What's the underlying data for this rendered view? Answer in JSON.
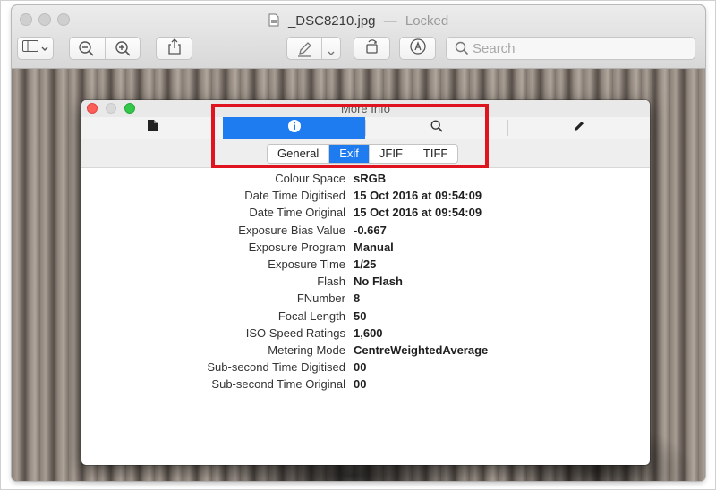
{
  "window": {
    "title": "_DSC8210.jpg",
    "separator": "—",
    "state": "Locked"
  },
  "toolbar": {
    "icons": [
      "sidebar-icon",
      "chevron-down-icon",
      "zoom-out-icon",
      "zoom-in-icon",
      "share-icon",
      "markup-pen-icon",
      "chevron-down-icon",
      "rotate-icon",
      "annotate-icon",
      "search-icon"
    ]
  },
  "search": {
    "placeholder": "Search",
    "value": ""
  },
  "info_panel": {
    "title": "More Info",
    "tabs": [
      {
        "icon": "document-icon",
        "active": false
      },
      {
        "icon": "info-icon",
        "active": true
      },
      {
        "icon": "magnifier-icon",
        "active": false
      },
      {
        "icon": "pencil-icon",
        "active": false
      }
    ],
    "sub_tabs": [
      {
        "label": "General",
        "active": false
      },
      {
        "label": "Exif",
        "active": true
      },
      {
        "label": "JFIF",
        "active": false
      },
      {
        "label": "TIFF",
        "active": false
      }
    ],
    "exif": [
      {
        "key": "Colour Space",
        "value": "sRGB"
      },
      {
        "key": "Date Time Digitised",
        "value": "15 Oct 2016 at 09:54:09"
      },
      {
        "key": "Date Time Original",
        "value": "15 Oct 2016 at 09:54:09"
      },
      {
        "key": "Exposure Bias Value",
        "value": "-0.667"
      },
      {
        "key": "Exposure Program",
        "value": "Manual"
      },
      {
        "key": "Exposure Time",
        "value": "1/25"
      },
      {
        "key": "Flash",
        "value": "No Flash"
      },
      {
        "key": "FNumber",
        "value": "8"
      },
      {
        "key": "Focal Length",
        "value": "50"
      },
      {
        "key": "ISO Speed Ratings",
        "value": "1,600"
      },
      {
        "key": "Metering Mode",
        "value": "CentreWeightedAverage"
      },
      {
        "key": "Sub-second Time Digitised",
        "value": "00"
      },
      {
        "key": "Sub-second Time Original",
        "value": "00"
      }
    ]
  },
  "colors": {
    "accent": "#1e7bf0",
    "highlight": "#e0141e"
  }
}
